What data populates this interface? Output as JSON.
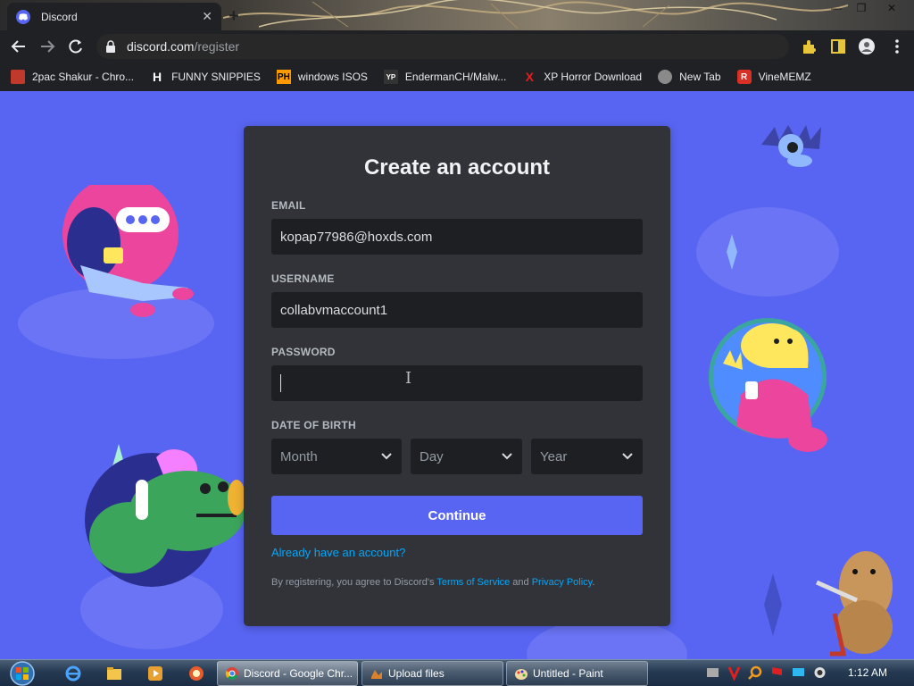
{
  "browser": {
    "tab_title": "Discord",
    "tab_close": "✕",
    "new_tab": "+",
    "window_controls": {
      "minimize": "—",
      "maximize": "❐",
      "close": "✕"
    },
    "url_domain": "discord.com",
    "url_path": "/register",
    "bookmarks": [
      {
        "label": "2pac Shakur - Chro...",
        "icon": "bookmark-icon",
        "icon_text": "",
        "color": "#c0392b"
      },
      {
        "label": "FUNNY SNIPPIES",
        "icon": "h-icon",
        "icon_text": "H",
        "color": "#ffffff"
      },
      {
        "label": "windows ISOS",
        "icon": "ph-icon",
        "icon_text": "PH",
        "color": "#ff9900"
      },
      {
        "label": "EndermanCH/Malw...",
        "icon": "yp-icon",
        "icon_text": "YP",
        "color": "#333333"
      },
      {
        "label": "XP Horror Download",
        "icon": "x-icon",
        "icon_text": "X",
        "color": "#e02020"
      },
      {
        "label": "New Tab",
        "icon": "globe-icon",
        "icon_text": "",
        "color": "#8a8a8a"
      },
      {
        "label": "VineMEMZ",
        "icon": "r-icon",
        "icon_text": "R",
        "color": "#d93025"
      }
    ]
  },
  "form": {
    "title": "Create an account",
    "email_label": "EMAIL",
    "email_value": "kopap77986@hoxds.com",
    "username_label": "USERNAME",
    "username_value": "collabvmaccount1",
    "password_label": "PASSWORD",
    "password_value": "",
    "dob_label": "DATE OF BIRTH",
    "month_placeholder": "Month",
    "day_placeholder": "Day",
    "year_placeholder": "Year",
    "continue_label": "Continue",
    "login_link": "Already have an account?",
    "terms_prefix": "By registering, you agree to Discord's ",
    "terms_link": "Terms of Service",
    "terms_and": " and ",
    "privacy_link": "Privacy Policy",
    "terms_suffix": "."
  },
  "taskbar": {
    "tasks": [
      {
        "label": "Discord - Google Chr...",
        "icon": "chrome-icon"
      },
      {
        "label": "Upload files",
        "icon": "upload-icon"
      },
      {
        "label": "Untitled - Paint",
        "icon": "paint-icon"
      }
    ],
    "clock": "1:12 AM"
  },
  "colors": {
    "blurple": "#5865f2",
    "card": "#313338",
    "input": "#1e1f22",
    "link": "#00a8fc"
  }
}
